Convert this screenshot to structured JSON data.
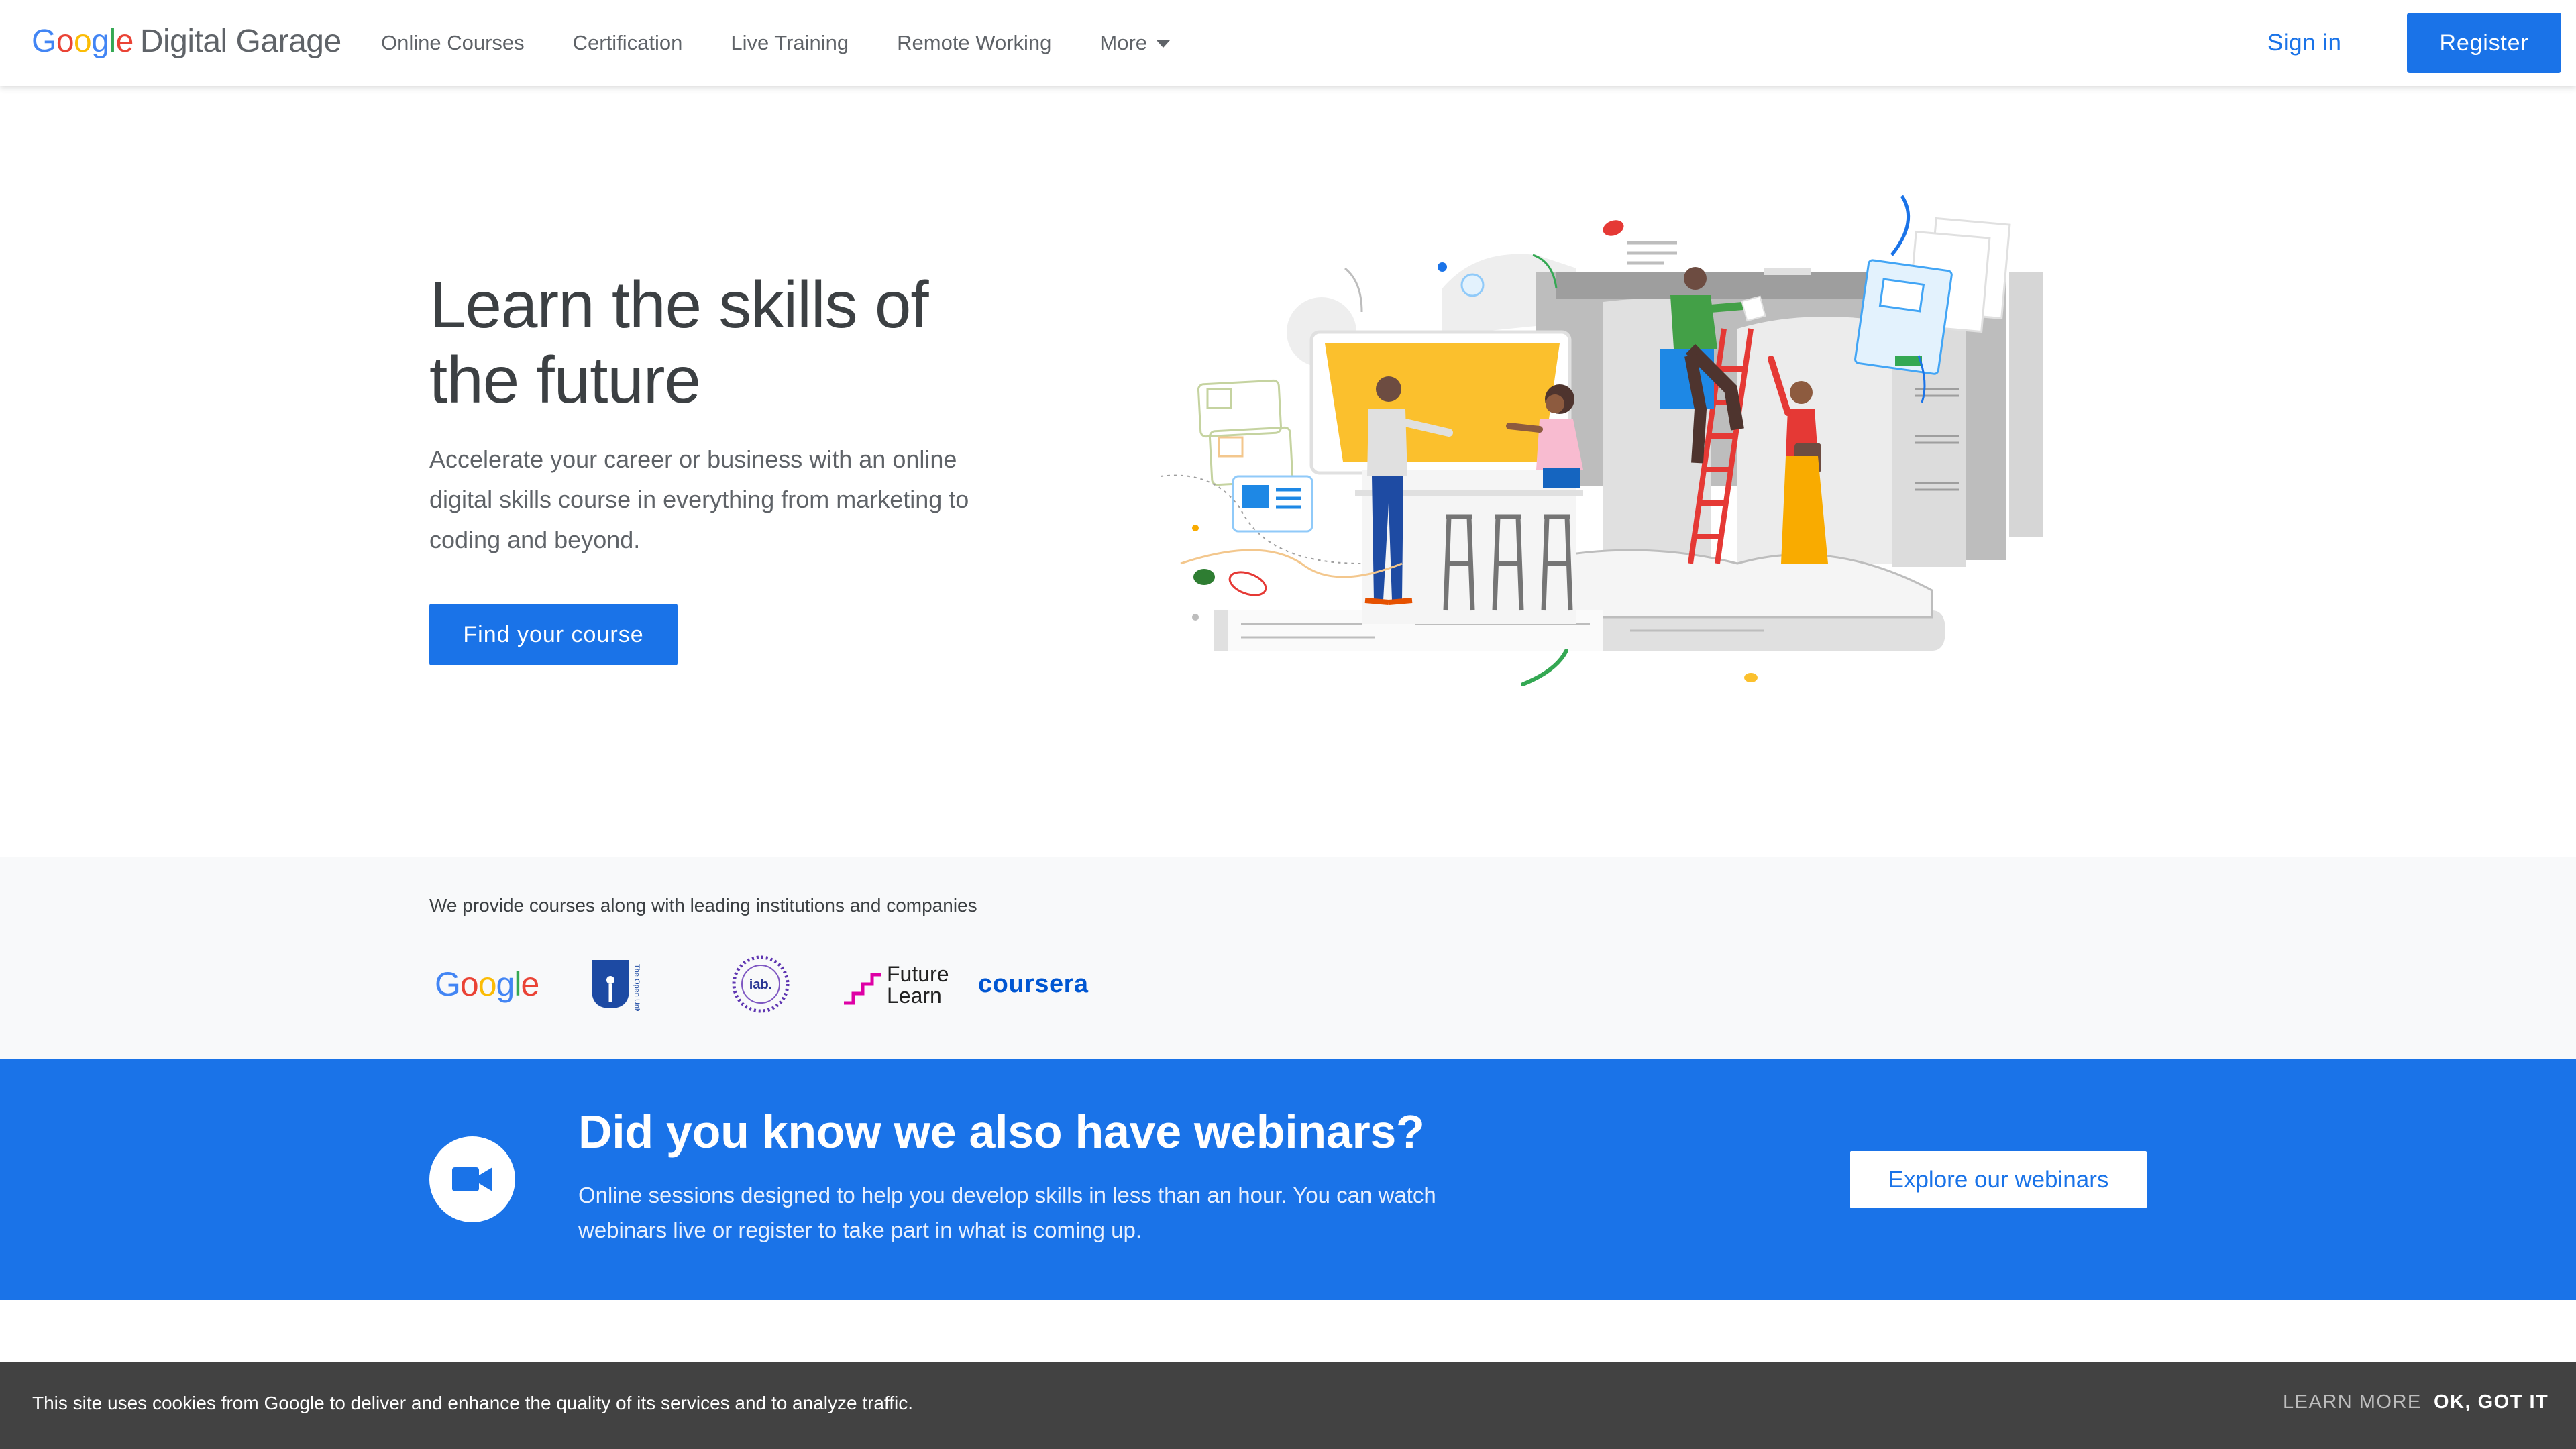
{
  "header": {
    "logo_google": [
      "G",
      "o",
      "o",
      "g",
      "l",
      "e"
    ],
    "logo_google_colors": [
      "#4285F4",
      "#EA4335",
      "#FBBC05",
      "#4285F4",
      "#34A853",
      "#EA4335"
    ],
    "logo_product": "Digital Garage",
    "nav": [
      {
        "label": "Online Courses"
      },
      {
        "label": "Certification"
      },
      {
        "label": "Live Training"
      },
      {
        "label": "Remote Working"
      }
    ],
    "more_label": "More",
    "more_icon": "caret-down-icon",
    "signin_label": "Sign in",
    "register_label": "Register"
  },
  "hero": {
    "title_line1": "Learn the skills of",
    "title_line2": "the future",
    "subtitle": "Accelerate your career or business with an online digital skills course in everything from marketing to coding and beyond.",
    "cta_label": "Find your course"
  },
  "partners": {
    "label": "We provide courses along with leading institutions and companies",
    "logos": {
      "google": "Google",
      "open_university": "The Open University",
      "iab": "iab.",
      "futurelearn_line1": "Future",
      "futurelearn_line2": "Learn",
      "coursera": "coursera"
    }
  },
  "webinar": {
    "icon": "video-camera-icon",
    "title": "Did you know we also have webinars?",
    "subtitle": "Online sessions designed to help you develop skills in less than an hour. You can watch webinars live or register to take part in what is coming up.",
    "button_label": "Explore our webinars"
  },
  "cookie": {
    "text": "This site uses cookies from Google to deliver and enhance the quality of its services and to analyze traffic.",
    "learn_more": "LEARN MORE",
    "ok": "OK, GOT IT"
  },
  "colors": {
    "accent": "#1a73e8",
    "cookie_bg": "#424242",
    "partners_bg": "#f8f9fa"
  }
}
